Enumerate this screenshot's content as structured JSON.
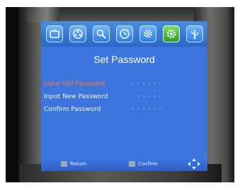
{
  "screen": {
    "title": "Set Password",
    "fields": [
      {
        "label": "Input Old Password",
        "value": "· · · · · ·"
      },
      {
        "label": "Input New Password",
        "value": "· · · · · ·"
      },
      {
        "label": "Confirm Password",
        "value": "· · · · · ·"
      }
    ],
    "footer": {
      "return_label": "Return",
      "confirm_label": "Confirm"
    }
  },
  "tabs": [
    {
      "icon": "tv-icon"
    },
    {
      "icon": "film-reel-icon"
    },
    {
      "icon": "search-icon"
    },
    {
      "icon": "clock-icon"
    },
    {
      "icon": "gear-icon"
    },
    {
      "icon": "gear-active-icon"
    },
    {
      "icon": "usb-icon"
    }
  ],
  "colors": {
    "selected_text": "#ff7a2a",
    "panel": "#3d75df",
    "active_tab": "#2f9a2c"
  }
}
